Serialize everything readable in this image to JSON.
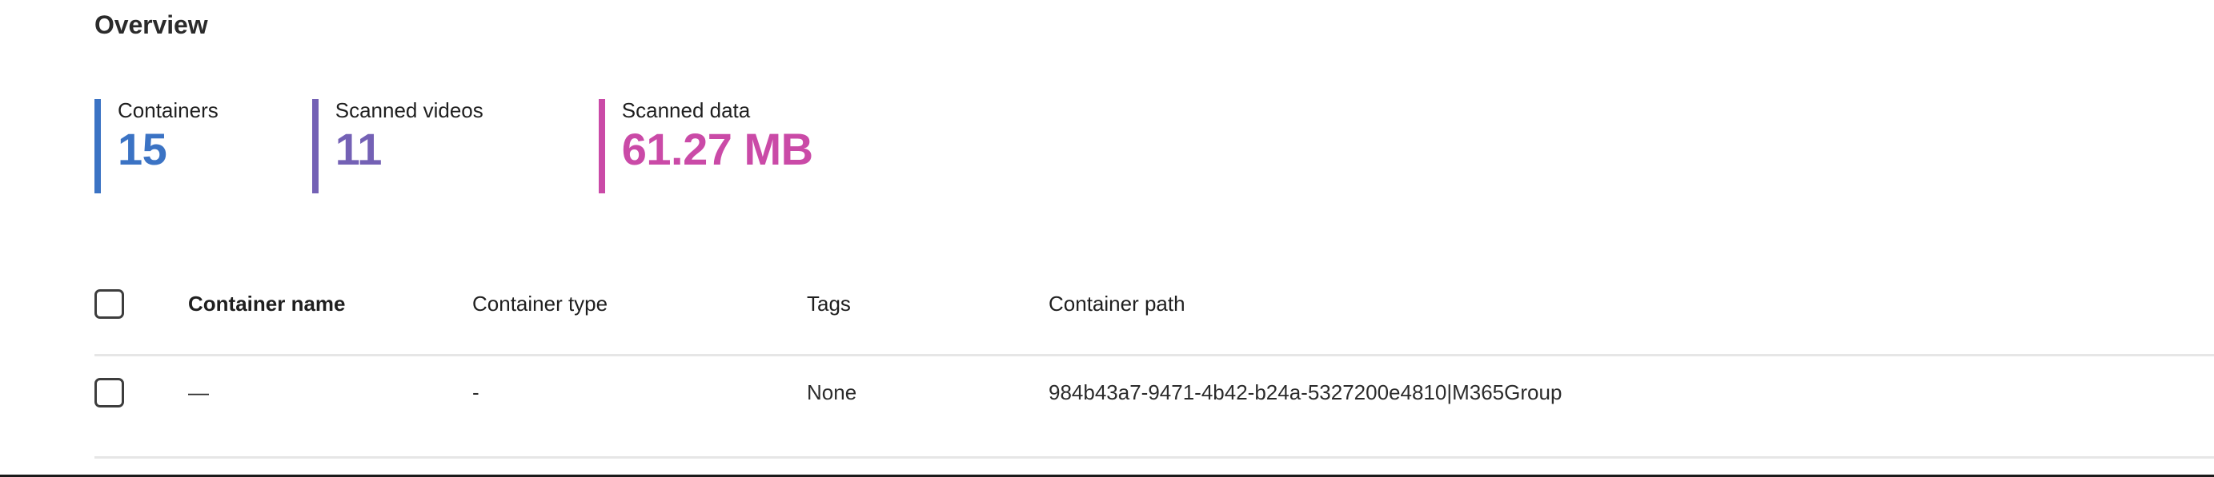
{
  "section": {
    "title": "Overview"
  },
  "stats": [
    {
      "label": "Containers",
      "value": "15",
      "color": "#3b73c4"
    },
    {
      "label": "Scanned videos",
      "value": "11",
      "color": "#7461b5"
    },
    {
      "label": "Scanned data",
      "value": "61.27 MB",
      "color": "#ca4aa7"
    }
  ],
  "table": {
    "select_all_checkbox": "unchecked",
    "columns": [
      {
        "key": "name",
        "label": "Container name",
        "bold": true
      },
      {
        "key": "type",
        "label": "Container type",
        "bold": false
      },
      {
        "key": "tags",
        "label": "Tags",
        "bold": false
      },
      {
        "key": "path",
        "label": "Container path",
        "bold": false
      }
    ],
    "rows": [
      {
        "checkbox": "unchecked",
        "name": "—",
        "type": "-",
        "tags": "None",
        "path": "984b43a7-9471-4b42-b24a-5327200e4810|M365Group"
      }
    ]
  },
  "colors": {
    "title": "#2b2b2b",
    "text": "#1f1f1f",
    "divider": "#e6e6e6",
    "bottom_rule": "#1a1a1a",
    "checkbox_border": "#3d3d3d"
  }
}
